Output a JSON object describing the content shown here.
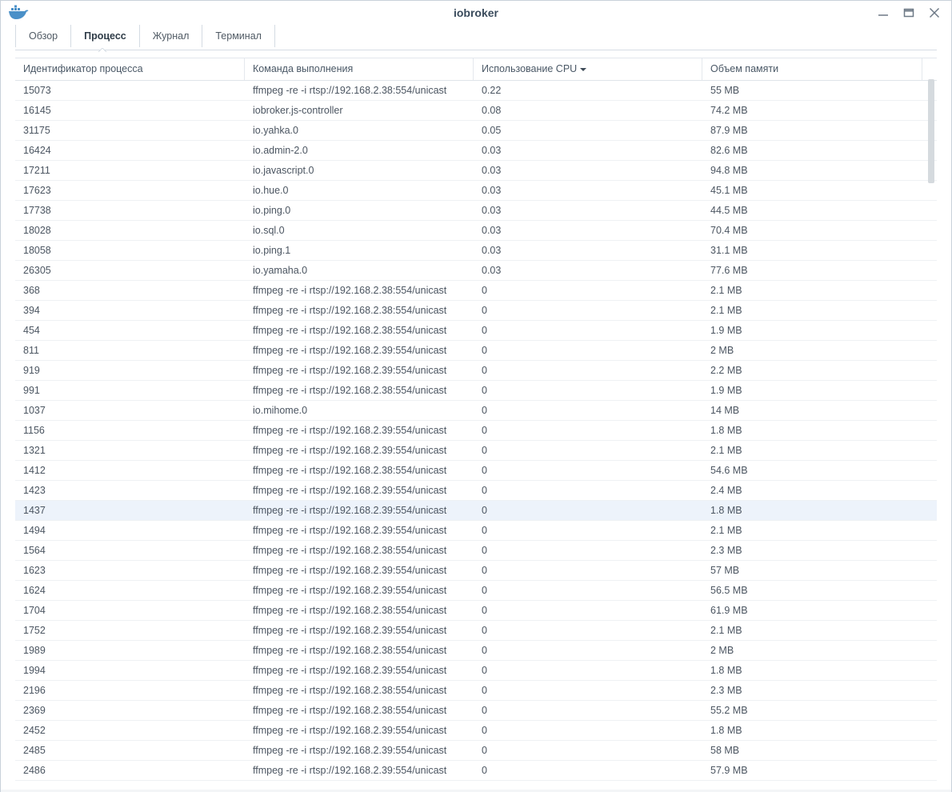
{
  "window": {
    "title": "iobroker",
    "app_icon": "docker-whale-icon",
    "controls": [
      "minimize-icon",
      "maximize-icon",
      "close-icon"
    ]
  },
  "tabs": [
    {
      "label": "Обзор",
      "active": false
    },
    {
      "label": "Процесс",
      "active": true
    },
    {
      "label": "Журнал",
      "active": false
    },
    {
      "label": "Терминал",
      "active": false
    }
  ],
  "table": {
    "columns": [
      {
        "label": "Идентификатор процесса"
      },
      {
        "label": "Команда выполнения"
      },
      {
        "label": "Использование CPU",
        "sort": "desc"
      },
      {
        "label": "Объем памяти"
      }
    ],
    "selected_row_index": 21,
    "rows": [
      {
        "pid": "15073",
        "cmd": "ffmpeg -re -i rtsp://192.168.2.38:554/unicast",
        "cpu": "0.22",
        "mem": "55 MB"
      },
      {
        "pid": "16145",
        "cmd": "iobroker.js-controller",
        "cpu": "0.08",
        "mem": "74.2 MB"
      },
      {
        "pid": "31175",
        "cmd": "io.yahka.0",
        "cpu": "0.05",
        "mem": "87.9 MB"
      },
      {
        "pid": "16424",
        "cmd": "io.admin-2.0",
        "cpu": "0.03",
        "mem": "82.6 MB"
      },
      {
        "pid": "17211",
        "cmd": "io.javascript.0",
        "cpu": "0.03",
        "mem": "94.8 MB"
      },
      {
        "pid": "17623",
        "cmd": "io.hue.0",
        "cpu": "0.03",
        "mem": "45.1 MB"
      },
      {
        "pid": "17738",
        "cmd": "io.ping.0",
        "cpu": "0.03",
        "mem": "44.5 MB"
      },
      {
        "pid": "18028",
        "cmd": "io.sql.0",
        "cpu": "0.03",
        "mem": "70.4 MB"
      },
      {
        "pid": "18058",
        "cmd": "io.ping.1",
        "cpu": "0.03",
        "mem": "31.1 MB"
      },
      {
        "pid": "26305",
        "cmd": "io.yamaha.0",
        "cpu": "0.03",
        "mem": "77.6 MB"
      },
      {
        "pid": "368",
        "cmd": "ffmpeg -re -i rtsp://192.168.2.38:554/unicast",
        "cpu": "0",
        "mem": "2.1 MB"
      },
      {
        "pid": "394",
        "cmd": "ffmpeg -re -i rtsp://192.168.2.38:554/unicast",
        "cpu": "0",
        "mem": "2.1 MB"
      },
      {
        "pid": "454",
        "cmd": "ffmpeg -re -i rtsp://192.168.2.38:554/unicast",
        "cpu": "0",
        "mem": "1.9 MB"
      },
      {
        "pid": "811",
        "cmd": "ffmpeg -re -i rtsp://192.168.2.39:554/unicast",
        "cpu": "0",
        "mem": "2 MB"
      },
      {
        "pid": "919",
        "cmd": "ffmpeg -re -i rtsp://192.168.2.39:554/unicast",
        "cpu": "0",
        "mem": "2.2 MB"
      },
      {
        "pid": "991",
        "cmd": "ffmpeg -re -i rtsp://192.168.2.38:554/unicast",
        "cpu": "0",
        "mem": "1.9 MB"
      },
      {
        "pid": "1037",
        "cmd": "io.mihome.0",
        "cpu": "0",
        "mem": "14 MB"
      },
      {
        "pid": "1156",
        "cmd": "ffmpeg -re -i rtsp://192.168.2.39:554/unicast",
        "cpu": "0",
        "mem": "1.8 MB"
      },
      {
        "pid": "1321",
        "cmd": "ffmpeg -re -i rtsp://192.168.2.39:554/unicast",
        "cpu": "0",
        "mem": "2.1 MB"
      },
      {
        "pid": "1412",
        "cmd": "ffmpeg -re -i rtsp://192.168.2.38:554/unicast",
        "cpu": "0",
        "mem": "54.6 MB"
      },
      {
        "pid": "1423",
        "cmd": "ffmpeg -re -i rtsp://192.168.2.39:554/unicast",
        "cpu": "0",
        "mem": "2.4 MB"
      },
      {
        "pid": "1437",
        "cmd": "ffmpeg -re -i rtsp://192.168.2.39:554/unicast",
        "cpu": "0",
        "mem": "1.8 MB"
      },
      {
        "pid": "1494",
        "cmd": "ffmpeg -re -i rtsp://192.168.2.39:554/unicast",
        "cpu": "0",
        "mem": "2.1 MB"
      },
      {
        "pid": "1564",
        "cmd": "ffmpeg -re -i rtsp://192.168.2.38:554/unicast",
        "cpu": "0",
        "mem": "2.3 MB"
      },
      {
        "pid": "1623",
        "cmd": "ffmpeg -re -i rtsp://192.168.2.39:554/unicast",
        "cpu": "0",
        "mem": "57 MB"
      },
      {
        "pid": "1624",
        "cmd": "ffmpeg -re -i rtsp://192.168.2.39:554/unicast",
        "cpu": "0",
        "mem": "56.5 MB"
      },
      {
        "pid": "1704",
        "cmd": "ffmpeg -re -i rtsp://192.168.2.38:554/unicast",
        "cpu": "0",
        "mem": "61.9 MB"
      },
      {
        "pid": "1752",
        "cmd": "ffmpeg -re -i rtsp://192.168.2.39:554/unicast",
        "cpu": "0",
        "mem": "2.1 MB"
      },
      {
        "pid": "1989",
        "cmd": "ffmpeg -re -i rtsp://192.168.2.38:554/unicast",
        "cpu": "0",
        "mem": "2 MB"
      },
      {
        "pid": "1994",
        "cmd": "ffmpeg -re -i rtsp://192.168.2.39:554/unicast",
        "cpu": "0",
        "mem": "1.8 MB"
      },
      {
        "pid": "2196",
        "cmd": "ffmpeg -re -i rtsp://192.168.2.38:554/unicast",
        "cpu": "0",
        "mem": "2.3 MB"
      },
      {
        "pid": "2369",
        "cmd": "ffmpeg -re -i rtsp://192.168.2.38:554/unicast",
        "cpu": "0",
        "mem": "55.2 MB"
      },
      {
        "pid": "2452",
        "cmd": "ffmpeg -re -i rtsp://192.168.2.39:554/unicast",
        "cpu": "0",
        "mem": "1.8 MB"
      },
      {
        "pid": "2485",
        "cmd": "ffmpeg -re -i rtsp://192.168.2.39:554/unicast",
        "cpu": "0",
        "mem": "58 MB"
      },
      {
        "pid": "2486",
        "cmd": "ffmpeg -re -i rtsp://192.168.2.39:554/unicast",
        "cpu": "0",
        "mem": "57.9 MB"
      }
    ]
  },
  "colors": {
    "title": "#3a4b5c",
    "text": "#4b5561",
    "selected_row": "#edf3fb",
    "whale": "#4a90c8"
  }
}
